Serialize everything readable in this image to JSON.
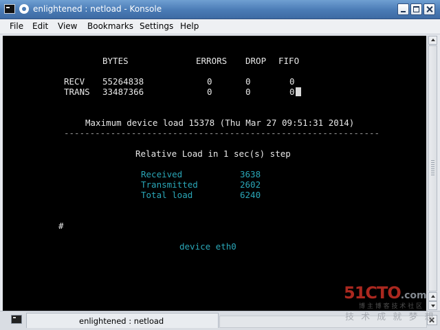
{
  "window": {
    "title": "enlightened : netload - Konsole",
    "icons": [
      "terminal-icon",
      "sticky-pin-icon",
      "minimize-icon",
      "maximize-icon",
      "close-icon"
    ]
  },
  "menubar": {
    "items": [
      "File",
      "Edit",
      "View",
      "Bookmarks",
      "Settings",
      "Help"
    ]
  },
  "terminal": {
    "header": {
      "bytes": "BYTES",
      "errors": "ERRORS",
      "drop": "DROP",
      "fifo": "FIFO"
    },
    "rows": [
      {
        "label": "RECV",
        "bytes": "55264838",
        "errors": "0",
        "drop": "0",
        "fifo": "0"
      },
      {
        "label": "TRANS",
        "bytes": "33487366",
        "errors": "0",
        "drop": "0",
        "fifo": "0"
      }
    ],
    "max_load": "Maximum device load 15378 (Thu Mar 27 09:51:31 2014)",
    "divider": "-------------------------------------------------------------",
    "relative_load": "Relative Load in 1 sec(s) step",
    "load_stats": [
      {
        "label": "Received",
        "value": "3638"
      },
      {
        "label": "Transmitted",
        "value": "2602"
      },
      {
        "label": "Total load",
        "value": "6240"
      }
    ],
    "prompt": "#",
    "device": "device eth0",
    "colors": {
      "background": "#000000",
      "text": "#e8e8e8",
      "accent": "#2aa7b8"
    }
  },
  "tabbar": {
    "tab_label": "enlightened : netload",
    "icons": [
      "new-tab-icon",
      "close-tab-icon"
    ]
  },
  "watermark": {
    "logo": "51CTO",
    "logo_suffix": ".com",
    "line1": "技 术 成 就 梦 想",
    "line2": "博 主 博 客 技 术 社 区"
  }
}
